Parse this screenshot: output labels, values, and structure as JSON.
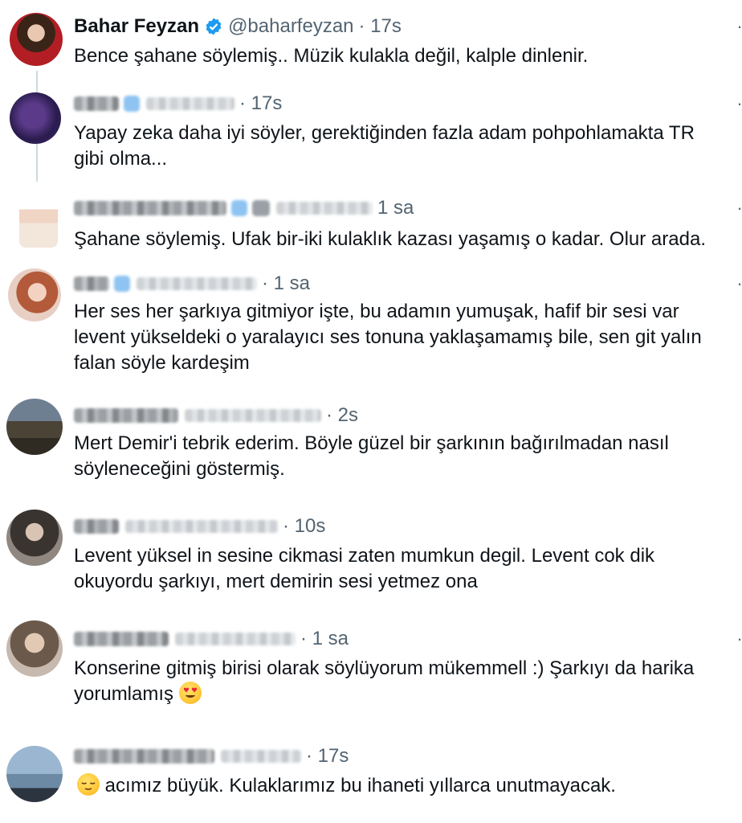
{
  "posts": [
    {
      "name": "Bahar Feyzan",
      "handle": "@baharfeyzan",
      "time": "· 17s",
      "text": "Bence şahane söylemiş.. Müzik kulakla değil, kalple dinlenir."
    },
    {
      "time": "· 17s",
      "text": "Yapay zeka daha iyi söyler, gerektiğinden fazla adam pohpohlamakta TR gibi olma..."
    },
    {
      "time": "1 sa",
      "text": "Şahane söylemiş. Ufak bir-iki kulaklık kazası yaşamış o kadar. Olur arada."
    },
    {
      "time": "· 1 sa",
      "text": "Her ses her şarkıya gitmiyor işte, bu adamın yumuşak, hafif bir sesi var levent yükseldeki o yaralayıcı ses tonuna yaklaşamamış bile, sen git yalın falan söyle kardeşim"
    },
    {
      "time": "· 2s",
      "text": "Mert Demir'i tebrik ederim. Böyle güzel bir şarkının bağırılmadan nasıl söyleneceğini göstermiş."
    },
    {
      "time": "· 10s",
      "text": "Levent yüksel in sesine cikmasi zaten mumkun degil. Levent cok dik okuyordu şarkıyı, mert demirin sesi yetmez ona"
    },
    {
      "time": "· 1 sa",
      "text": "Konserine gitmiş birisi olarak söylüyorum mükemmell :) Şarkıyı da harika yorumlamış"
    },
    {
      "time": "· 17s",
      "text": "acımız büyük. Kulaklarımız bu ihaneti yıllarca unutmayacak."
    }
  ],
  "more_glyph": "··",
  "colors": {
    "verified": "#1d9bf0",
    "secondary": "#536471",
    "text": "#0f1419"
  },
  "icons": {
    "verified": "verified-badge-icon",
    "more": "more-icon",
    "heart_eyes": "heart-eyes-emoji",
    "relieved": "relieved-emoji"
  }
}
